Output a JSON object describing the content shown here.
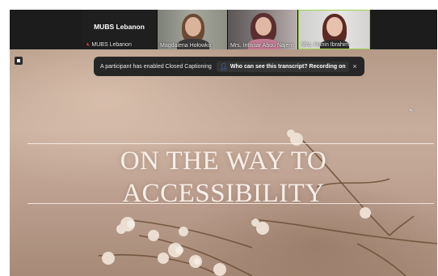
{
  "participants": {
    "host": {
      "title": "MUBS Lebanon",
      "label": "MUBS Lebanon",
      "muted_icon": "mic-off-icon"
    },
    "tiles": [
      {
        "name": "Magdalena Hołowko"
      },
      {
        "name": "Mrs. Intissar Abou Najem"
      },
      {
        "name": "Mrs. Hanin Ibrahim"
      }
    ]
  },
  "notice": {
    "message": "A participant has enabled Closed Captioning",
    "link_icon": "user-icon",
    "link_label": "Who can see this transcript? Recording on",
    "close_glyph": "×"
  },
  "slide": {
    "title_line1": "ON THE WAY TO",
    "title_line2": "ACCESSIBILITY"
  },
  "colors": {
    "strip_bg": "#1c1c1c",
    "notice_bg": "#262626",
    "active_speaker_border": "#9ad14b",
    "muted_red": "#e5484d",
    "slide_text": "#f7efe9"
  }
}
